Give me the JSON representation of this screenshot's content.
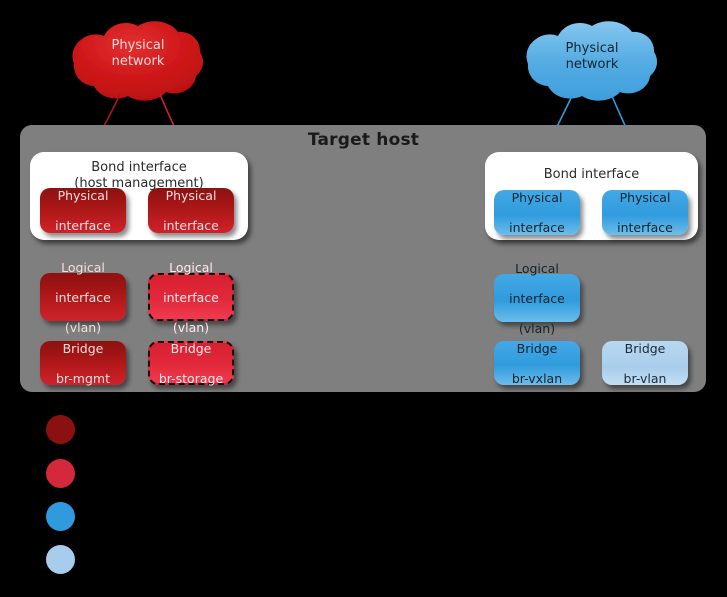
{
  "diagram": {
    "title": "Target host",
    "background": "#000000",
    "panel_color": "#7f7f7f"
  },
  "clouds": [
    {
      "id": "cloud-left",
      "label": "Physical\nnetwork",
      "line1": "Physical",
      "line2": "network",
      "color": "#cc1417",
      "text_color": "#f0dcdc"
    },
    {
      "id": "cloud-right",
      "label": "Physical\nnetwork",
      "line1": "Physical",
      "line2": "network",
      "color": "#4aa8e0",
      "text_color": "#122530"
    }
  ],
  "bonds": [
    {
      "id": "bond-left",
      "line1": "Bond interface",
      "line2": "(host management)"
    },
    {
      "id": "bond-right",
      "line1": "Bond interface",
      "line2": ""
    }
  ],
  "nodes": {
    "left_phys_1": {
      "line1": "Physical",
      "line2": "interface",
      "line3": "",
      "color": "#a81616"
    },
    "left_phys_2": {
      "line1": "Physical",
      "line2": "interface",
      "line3": "",
      "color": "#a81616"
    },
    "left_logical_mgmt": {
      "line1": "Logical",
      "line2": "interface",
      "line3": "(vlan)",
      "color": "#a81616"
    },
    "left_logical_storage": {
      "line1": "Logical",
      "line2": "interface",
      "line3": "(vlan)",
      "color": "#e2293c"
    },
    "left_bridge_mgmt": {
      "line1": "Bridge",
      "line2": "br-mgmt",
      "line3": "",
      "color": "#a81616"
    },
    "left_bridge_storage": {
      "line1": "Bridge",
      "line2": "br-storage",
      "line3": "",
      "color": "#e2293c"
    },
    "right_phys_1": {
      "line1": "Physical",
      "line2": "interface",
      "line3": "",
      "color": "#2f9bdd"
    },
    "right_phys_2": {
      "line1": "Physical",
      "line2": "interface",
      "line3": "",
      "color": "#2f9bdd"
    },
    "right_logical_vxlan": {
      "line1": "Logical",
      "line2": "interface",
      "line3": "(vlan)",
      "color": "#2f9bdd"
    },
    "right_bridge_vxlan": {
      "line1": "Bridge",
      "line2": "br-vxlan",
      "line3": "",
      "color": "#2f9bdd"
    },
    "right_bridge_vlan": {
      "line1": "Bridge",
      "line2": "br-vlan",
      "line3": "",
      "color": "#a8cdec"
    }
  },
  "legend": [
    {
      "color": "#8b1010",
      "label": ""
    },
    {
      "color": "#d4293c",
      "label": ""
    },
    {
      "color": "#2f9bdd",
      "label": ""
    },
    {
      "color": "#a8cdec",
      "label": ""
    }
  ]
}
